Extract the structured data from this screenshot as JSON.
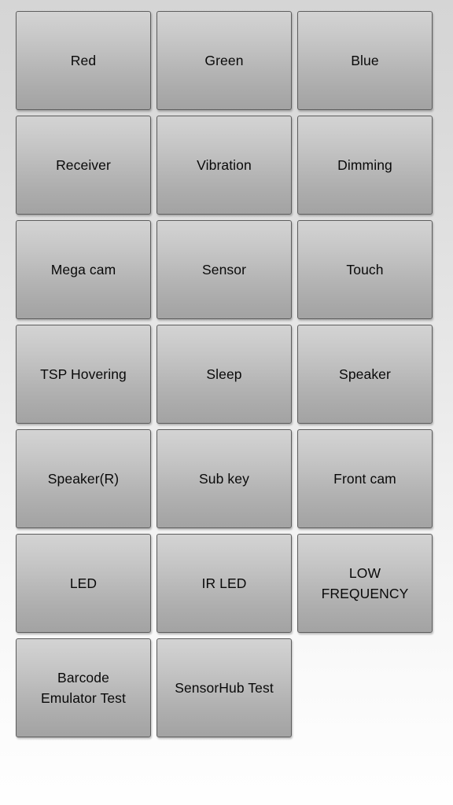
{
  "screen": {
    "name": "hardware-test-menu",
    "background_top_color": "#d5d5d5",
    "background_bottom_color": "#fefefe",
    "columns": 3,
    "rows": 7
  },
  "button_style": {
    "gradient_top_color": "#d3d3d3",
    "gradient_bottom_color": "#a3a3a3",
    "border_color": "#5d5d5d",
    "text_color": "#090909"
  },
  "buttons": [
    {
      "id": "red",
      "label": "Red"
    },
    {
      "id": "green",
      "label": "Green"
    },
    {
      "id": "blue",
      "label": "Blue"
    },
    {
      "id": "receiver",
      "label": "Receiver"
    },
    {
      "id": "vibration",
      "label": "Vibration"
    },
    {
      "id": "dimming",
      "label": "Dimming"
    },
    {
      "id": "mega-cam",
      "label": "Mega cam"
    },
    {
      "id": "sensor",
      "label": "Sensor"
    },
    {
      "id": "touch",
      "label": "Touch"
    },
    {
      "id": "tsp-hovering",
      "label": "TSP Hovering"
    },
    {
      "id": "sleep",
      "label": "Sleep"
    },
    {
      "id": "speaker",
      "label": "Speaker"
    },
    {
      "id": "speaker-r",
      "label": "Speaker(R)"
    },
    {
      "id": "sub-key",
      "label": "Sub key"
    },
    {
      "id": "front-cam",
      "label": "Front cam"
    },
    {
      "id": "led",
      "label": "LED"
    },
    {
      "id": "ir-led",
      "label": "IR LED"
    },
    {
      "id": "low-frequency",
      "label": "LOW\nFREQUENCY"
    },
    {
      "id": "barcode-emulator-test",
      "label": "Barcode\nEmulator Test"
    },
    {
      "id": "sensorhub-test",
      "label": "SensorHub Test"
    }
  ]
}
